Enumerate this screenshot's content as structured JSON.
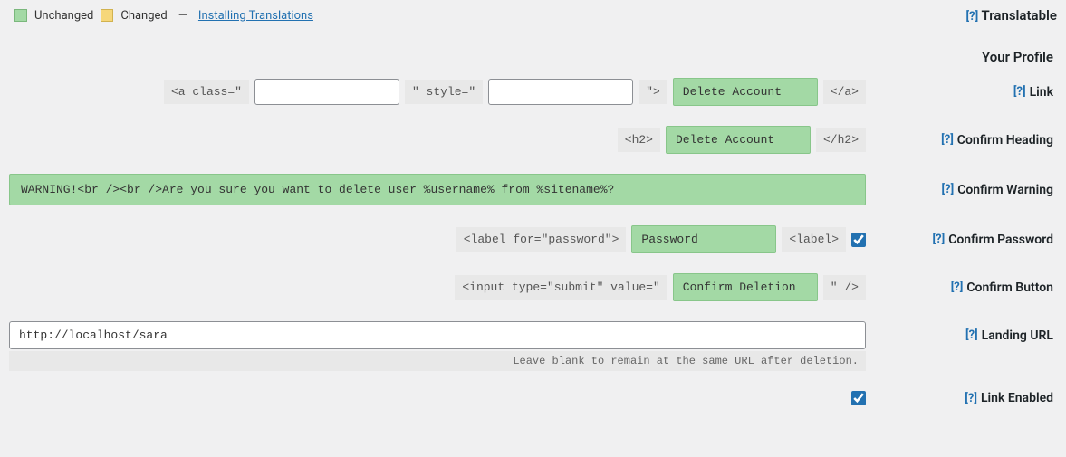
{
  "legend": {
    "unchanged": "Unchanged",
    "changed": "Changed",
    "dash": "—",
    "installing_link": "Installing Translations"
  },
  "translatable": {
    "help": "[?]",
    "label": "Translatable"
  },
  "section_title": "Your Profile",
  "rows": {
    "link": {
      "prefix1": "<a class=\"",
      "class_val": "",
      "prefix2": "\" style=\"",
      "style_val": "",
      "prefix3": "\">",
      "value": "Delete Account",
      "suffix": "</a>",
      "help": "[?]",
      "label": "Link"
    },
    "confirm_heading": {
      "prefix": "<h2>",
      "value": "Delete Account",
      "suffix": "</h2>",
      "help": "[?]",
      "label": "Confirm Heading"
    },
    "confirm_warning": {
      "value": "WARNING!<br /><br />Are you sure you want to delete user %username% from %sitename%?",
      "help": "[?]",
      "label": "Confirm Warning"
    },
    "confirm_password": {
      "prefix": "<label for=\"password\">",
      "value": "Password",
      "suffix": "<label>",
      "help": "[?]",
      "label": "Confirm Password"
    },
    "confirm_button": {
      "prefix": "<input type=\"submit\" value=\"",
      "value": "Confirm Deletion",
      "suffix": "\" />",
      "help": "[?]",
      "label": "Confirm Button"
    },
    "landing_url": {
      "value": "http://localhost/sara",
      "helper": "Leave blank to remain at the same URL after deletion.",
      "help": "[?]",
      "label": "Landing URL"
    },
    "link_enabled": {
      "help": "[?]",
      "label": "Link Enabled"
    }
  }
}
